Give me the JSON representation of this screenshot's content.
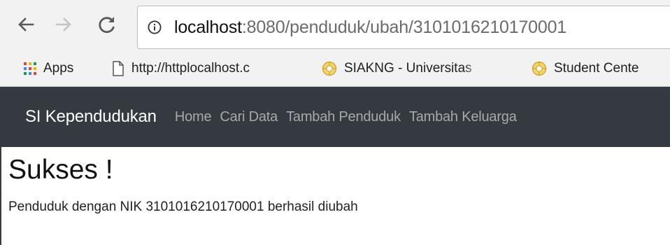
{
  "browser": {
    "url": {
      "host": "localhost",
      "rest": ":8080/penduduk/ubah/3101016210170001"
    },
    "bookmarks": [
      {
        "label": "Apps",
        "icon": "apps-grid-icon"
      },
      {
        "label": "http://httplocalhost.c",
        "icon": "page-icon"
      },
      {
        "label": "SIAKNG - Universitas",
        "icon": "ui-logo-icon"
      },
      {
        "label": "Student Cente",
        "icon": "ui-logo-icon"
      }
    ],
    "icons": {
      "back": "back-arrow-icon",
      "forward": "forward-arrow-icon",
      "reload": "reload-icon",
      "site_info": "info-icon"
    }
  },
  "navbar": {
    "brand": "SI Kependudukan",
    "links": [
      "Home",
      "Cari Data",
      "Tambah Penduduk",
      "Tambah Keluarga"
    ],
    "background": "#343a40",
    "link_color": "#a6a9ad"
  },
  "content": {
    "title": "Sukses !",
    "message": "Penduduk dengan NIK 3101016210170001 berhasil diubah"
  }
}
